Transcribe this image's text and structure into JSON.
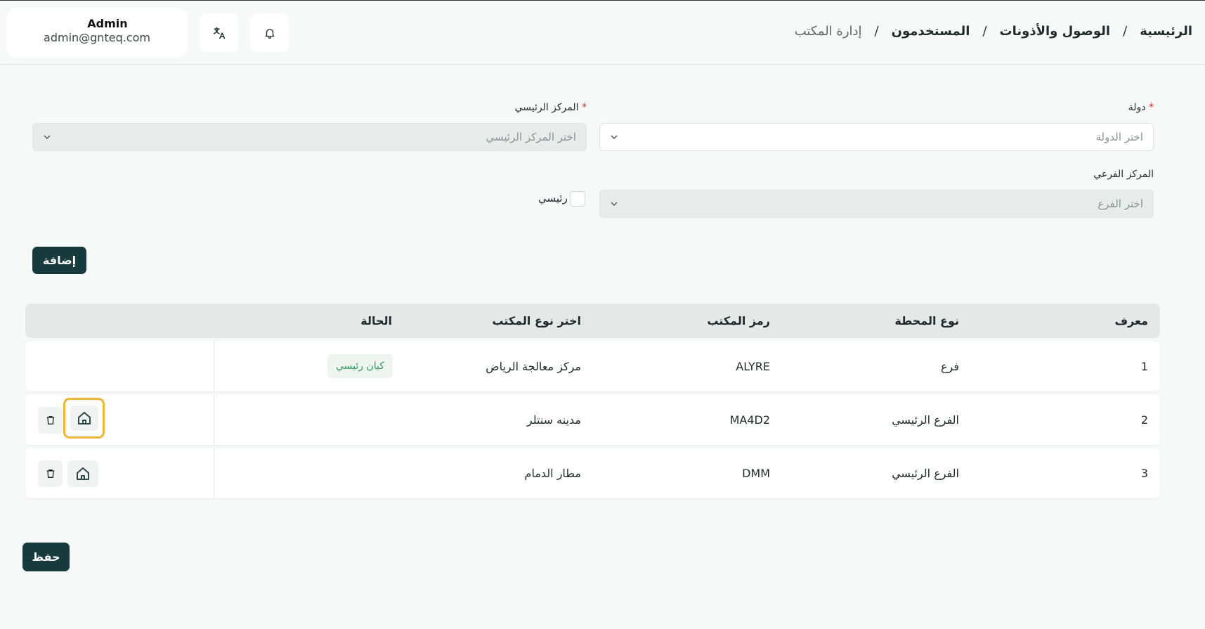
{
  "header": {
    "user_name": "Admin",
    "user_email": "admin@gnteq.com",
    "breadcrumb": [
      "الرئيسية",
      "الوصول والأذونات",
      "المستخدمون",
      "إدارة المكتب"
    ],
    "separator": "/"
  },
  "form": {
    "country_label": "دولة",
    "country_placeholder": "اختر الدولة",
    "main_center_label": "المركز الرئيسي",
    "main_center_placeholder": "اختر المركز الرئيسي",
    "required_mark": "*",
    "sub_center_label": "المركز الفرعي",
    "sub_center_placeholder": "اختر الفرع",
    "main_checkbox_label": "رئيسي",
    "add_button": "إضافة"
  },
  "table": {
    "columns": [
      "معرف",
      "نوع المحطة",
      "رمز المكتب",
      "اختر نوع المكتب",
      "الحالة"
    ],
    "rows": [
      {
        "id": "1",
        "station_type": "فرع",
        "office_code": "ALYRE",
        "office_type": "مركز معالجة الرياض",
        "status": "كيان رئيسي"
      },
      {
        "id": "2",
        "station_type": "الفرع الرئيسي",
        "office_code": "MA4D2",
        "office_type": "مدينه سنتلر",
        "status": ""
      },
      {
        "id": "3",
        "station_type": "الفرع الرئيسي",
        "office_code": "DMM",
        "office_type": "مطار الدمام",
        "status": ""
      }
    ]
  },
  "save_button": "حفظ",
  "colors": {
    "accent": "#173a3c",
    "badge_text": "#2e9a5a",
    "highlight": "#f0b43c",
    "required": "#d0262d"
  }
}
